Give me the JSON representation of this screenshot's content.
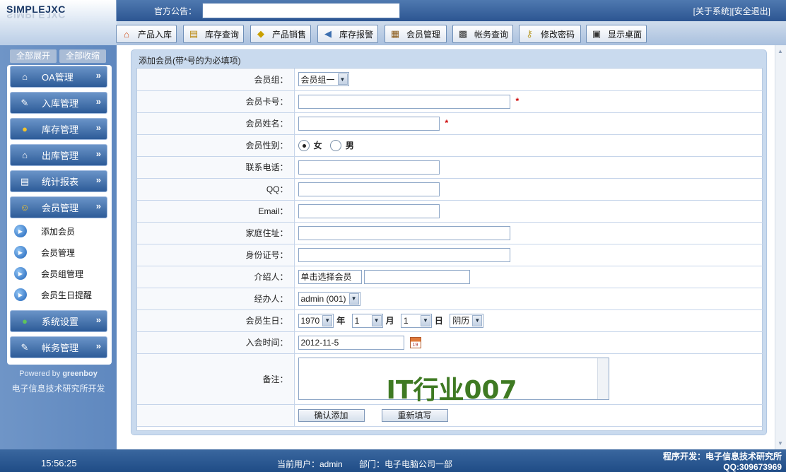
{
  "header": {
    "logo": "SIMPLEJXC",
    "notice_label": "官方公告：",
    "notice_value": "",
    "about": "[关于系统]",
    "logout": "[安全退出]"
  },
  "nav": [
    {
      "label": "产品入库",
      "icon": "house-in-icon"
    },
    {
      "label": "库存查询",
      "icon": "book-icon"
    },
    {
      "label": "产品销售",
      "icon": "tag-icon"
    },
    {
      "label": "库存报警",
      "icon": "speaker-icon"
    },
    {
      "label": "会员管理",
      "icon": "member-card-icon"
    },
    {
      "label": "帐务查询",
      "icon": "ledger-icon"
    },
    {
      "label": "修改密码",
      "icon": "keys-icon"
    },
    {
      "label": "显示桌面",
      "icon": "desktop-icon"
    }
  ],
  "sidebar": {
    "expand_all": "全部展开",
    "collapse_all": "全部收缩",
    "menus": [
      {
        "label": "OA管理"
      },
      {
        "label": "入库管理"
      },
      {
        "label": "库存管理"
      },
      {
        "label": "出库管理"
      },
      {
        "label": "统计报表"
      },
      {
        "label": "会员管理"
      },
      {
        "label": "系统设置"
      },
      {
        "label": "帐务管理"
      }
    ],
    "sub_items": [
      "添加会员",
      "会员管理",
      "会员组管理",
      "会员生日提醒"
    ],
    "powered_prefix": "Powered by",
    "powered_by": "greenboy",
    "developer": "电子信息技术研究所开发"
  },
  "form": {
    "title": "添加会员(带*号的为必填项)",
    "labels": {
      "group": "会员组：",
      "card_no": "会员卡号：",
      "name": "会员姓名：",
      "gender": "会员性别：",
      "phone": "联系电话：",
      "qq": "QQ：",
      "email": "Email：",
      "address": "家庭住址：",
      "id_no": "身份证号：",
      "referrer": "介绍人：",
      "handler": "经办人：",
      "birthday": "会员生日：",
      "join_time": "入会时间：",
      "remark": "备注："
    },
    "required_mark": "*",
    "group_value": "会员组一",
    "gender_female": "女",
    "gender_male": "男",
    "gender_selected": "女",
    "referrer_button": "单击选择会员",
    "handler_value": "admin (001)",
    "birth_year": "1970",
    "birth_month": "1",
    "birth_day": "1",
    "year_unit": "年",
    "month_unit": "月",
    "day_unit": "日",
    "calendar_type": "阴历",
    "join_time_value": "2012-11-5",
    "calendar_icon_text": "19",
    "remark_watermark": "IT行业007",
    "submit": "确认添加",
    "reset": "重新填写"
  },
  "footer": {
    "time": "15:56:25",
    "current_user": "当前用户：admin",
    "department": "部门：电子电脑公司一部",
    "credit_line1": "程序开发：电子信息技术研究所",
    "credit_line2": "QQ:309673969"
  }
}
